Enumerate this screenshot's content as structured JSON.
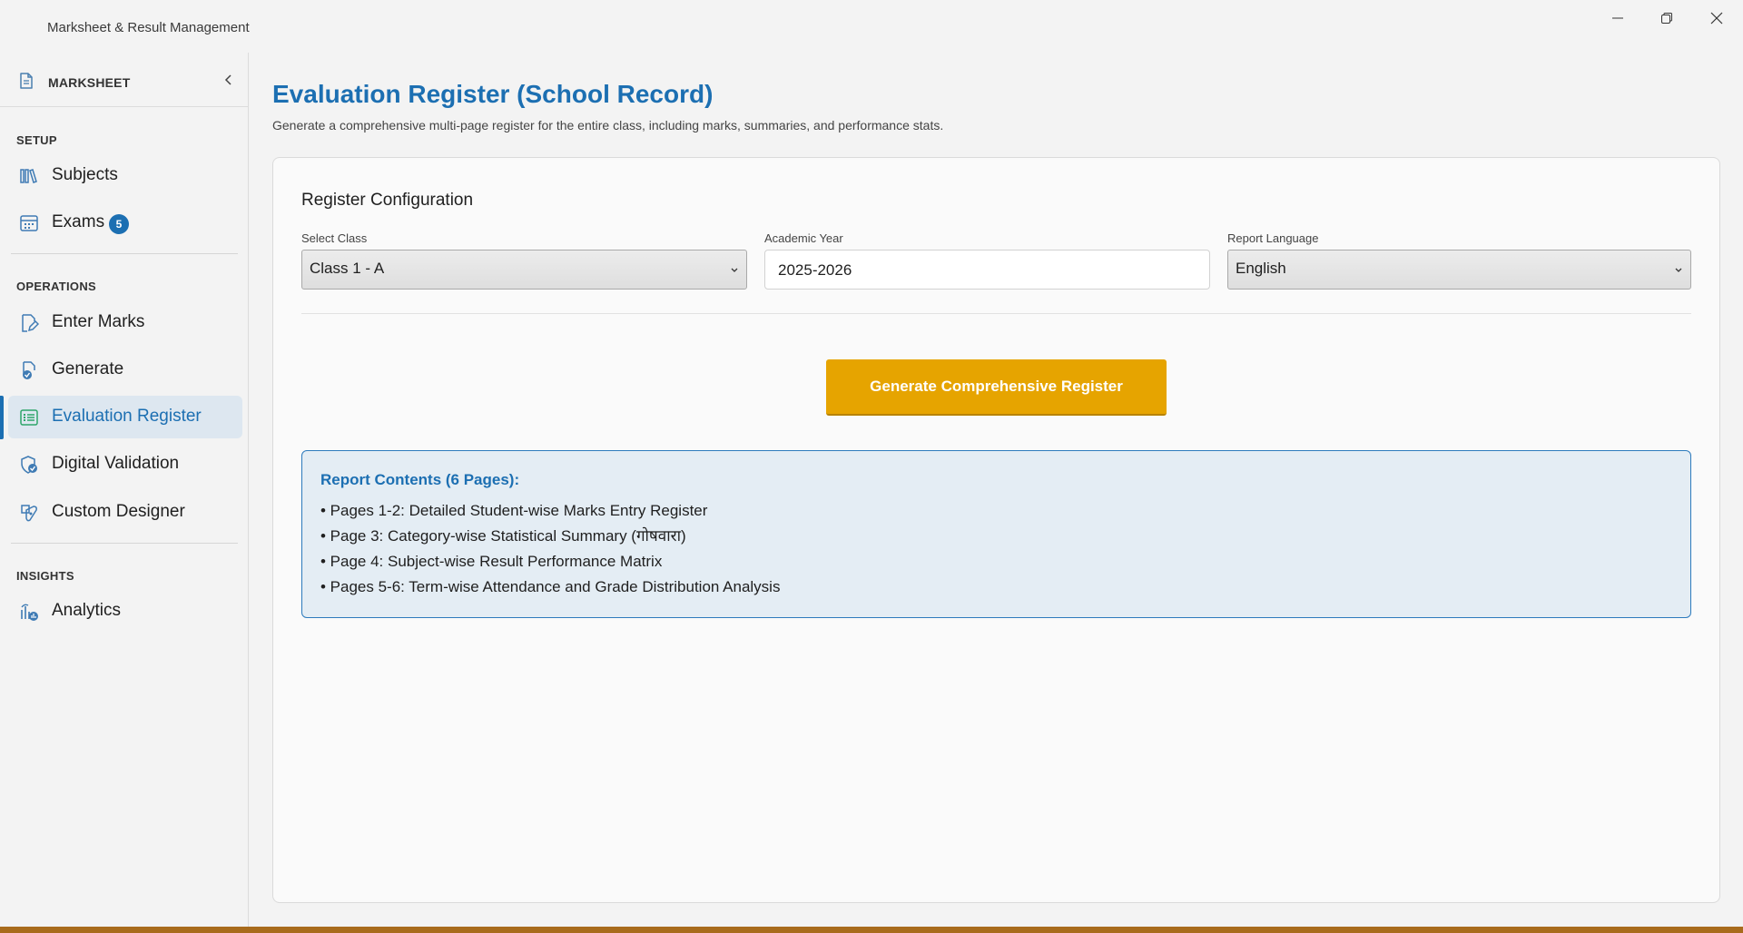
{
  "window": {
    "title": "Marksheet & Result Management"
  },
  "sidebar": {
    "brand": "MARKSHEET",
    "sections": {
      "setup": "SETUP",
      "operations": "OPERATIONS",
      "insights": "INSIGHTS"
    },
    "items": [
      {
        "label": "Subjects",
        "icon": "books-icon"
      },
      {
        "label": "Exams",
        "icon": "calendar-icon",
        "badge": "5"
      },
      {
        "label": "Enter Marks",
        "icon": "edit-document-icon"
      },
      {
        "label": "Generate",
        "icon": "document-check-icon"
      },
      {
        "label": "Evaluation Register",
        "icon": "list-icon",
        "active": true
      },
      {
        "label": "Digital Validation",
        "icon": "shield-check-icon"
      },
      {
        "label": "Custom Designer",
        "icon": "design-icon"
      },
      {
        "label": "Analytics",
        "icon": "analytics-icon"
      }
    ]
  },
  "main": {
    "title": "Evaluation Register (School Record)",
    "subtitle": "Generate a comprehensive multi-page register for the entire class, including marks, summaries, and performance stats.",
    "card": {
      "title": "Register Configuration",
      "fields": {
        "class": {
          "label": "Select Class",
          "value": "Class 1 - A"
        },
        "year": {
          "label": "Academic Year",
          "value": "2025-2026"
        },
        "language": {
          "label": "Report Language",
          "value": "English"
        }
      },
      "generate_label": "Generate Comprehensive Register",
      "contents": {
        "title": "Report Contents (6 Pages):",
        "items": [
          "• Pages 1-2: Detailed Student-wise Marks Entry Register",
          "• Page 3: Category-wise Statistical Summary (गोषवारा)",
          "• Page 4: Subject-wise Result Performance Matrix",
          "• Pages 5-6: Term-wise Attendance and Grade Distribution Analysis"
        ]
      }
    }
  },
  "colors": {
    "accent": "#1c6fb2",
    "button": "#e6a400",
    "active_bg": "#dde7f0",
    "info_bg": "#e4edf4"
  }
}
